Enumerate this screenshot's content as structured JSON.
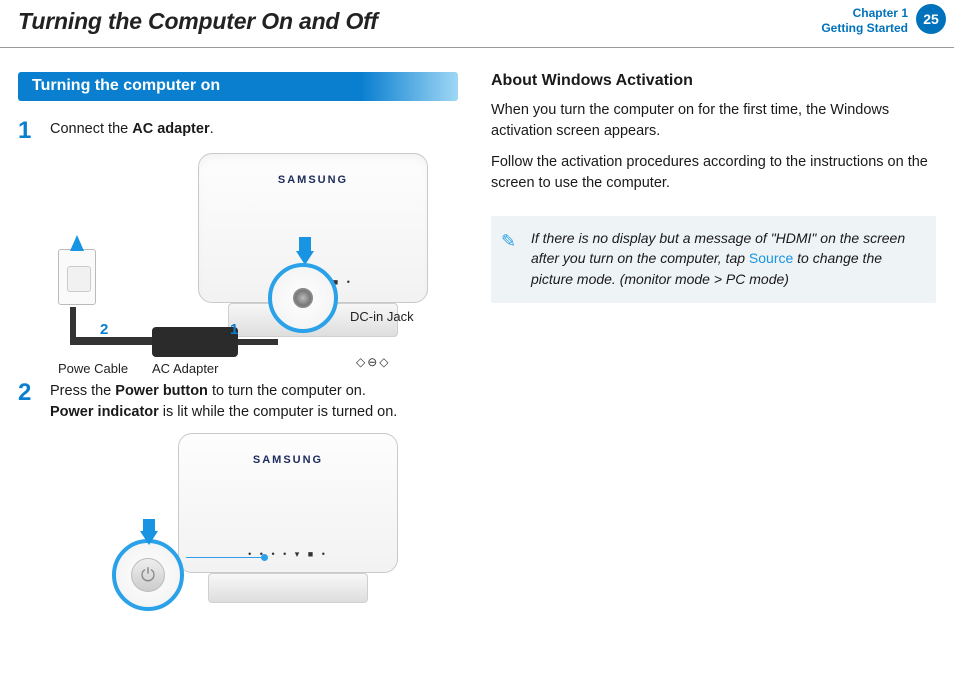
{
  "header": {
    "title": "Turning the Computer On and Off",
    "chapter_line1": "Chapter 1",
    "chapter_line2": "Getting Started",
    "page_number": "25"
  },
  "left": {
    "section_title": "Turning the computer on",
    "step1": {
      "num": "1",
      "pre": "Connect the ",
      "bold": "AC adapter",
      "post": "."
    },
    "illus1": {
      "brand": "SAMSUNG",
      "badge1": "1",
      "badge2": "2",
      "label_power_cable": "Powe Cable",
      "label_ac_adapter": "AC Adapter",
      "label_dc_in": "DC-in Jack",
      "dc_symbol": "◇⊖◇"
    },
    "step2": {
      "num": "2",
      "line1_pre": "Press the ",
      "line1_bold": "Power button",
      "line1_post": " to turn the computer on.",
      "line2_bold": "Power indicator",
      "line2_post": " is lit while the computer is turned on."
    },
    "illus2": {
      "brand": "SAMSUNG",
      "power_glyph": "⏻"
    }
  },
  "right": {
    "heading": "About Windows Activation",
    "p1": "When you turn the computer on for the first time, the Windows activation screen appears.",
    "p2": "Follow the activation procedures according to the instructions on the screen to use the computer.",
    "note_pre": "If there is no display but a message of \"HDMI\" on the screen after you turn on the computer, tap ",
    "note_source": "Source",
    "note_post": " to change the picture mode. (monitor mode > PC mode)"
  }
}
